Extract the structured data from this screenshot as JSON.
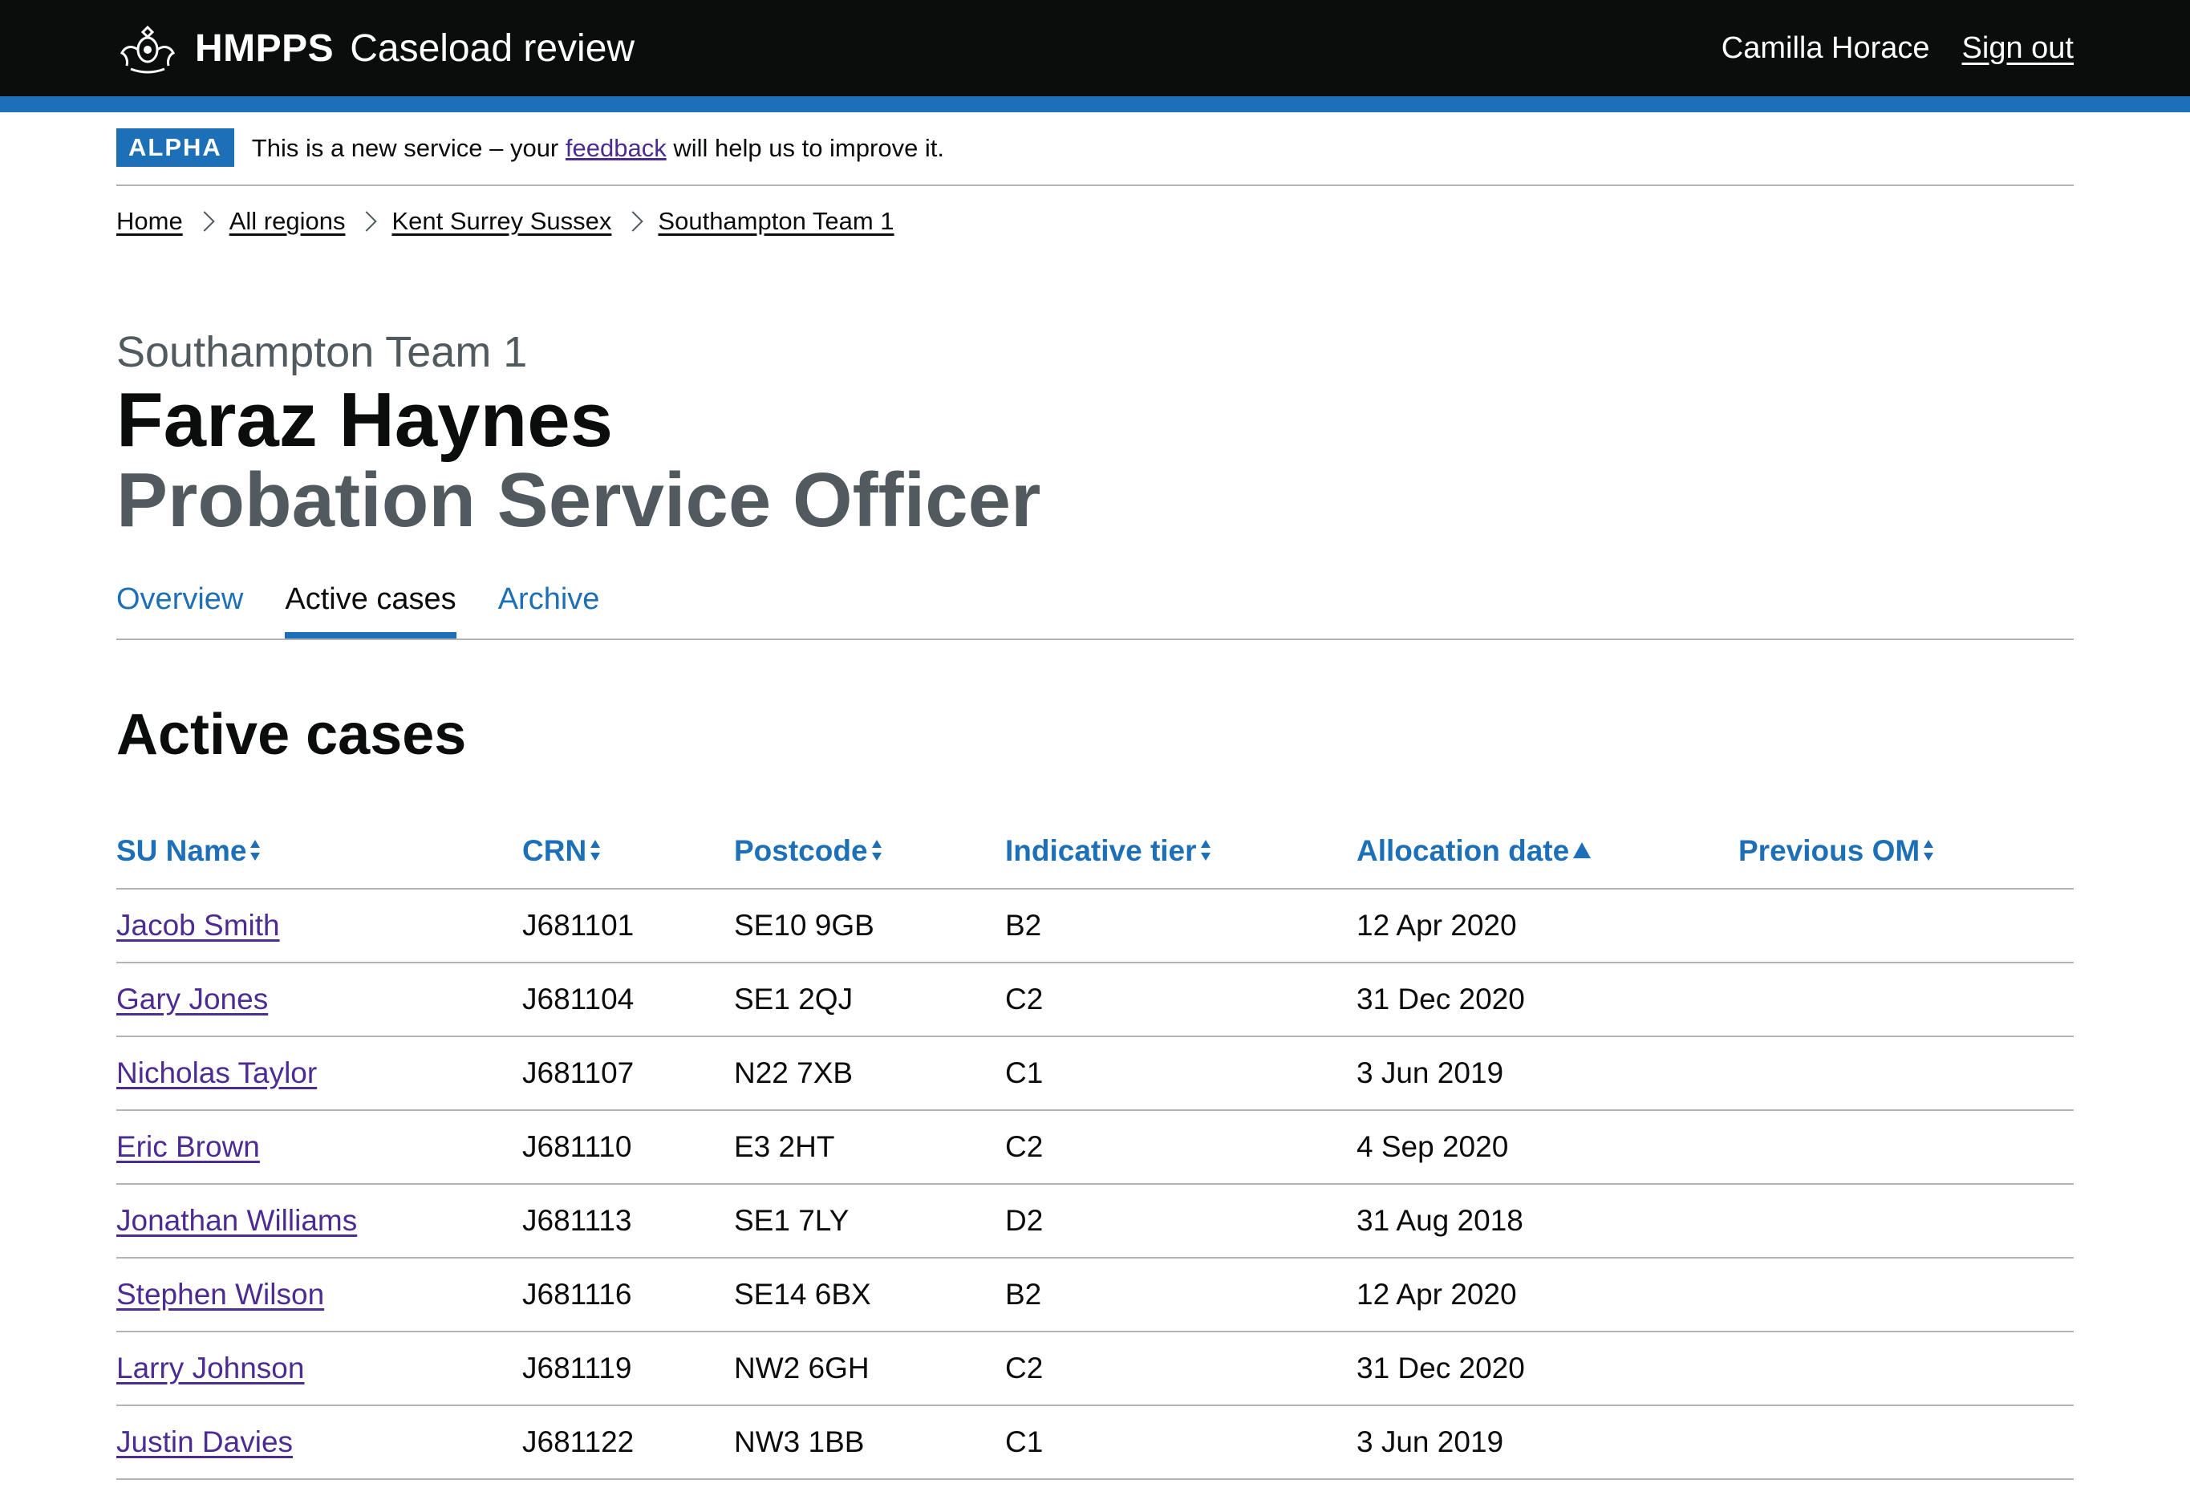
{
  "header": {
    "org": "HMPPS",
    "service": "Caseload review",
    "user_name": "Camilla Horace",
    "sign_out": "Sign out"
  },
  "phase_banner": {
    "tag": "ALPHA",
    "text_before": "This is a new service – your",
    "link": "feedback",
    "text_after": "will help us to improve it."
  },
  "breadcrumbs": [
    "Home",
    "All regions",
    "Kent Surrey Sussex",
    "Southampton Team 1"
  ],
  "caption": "Southampton Team 1",
  "title": "Faraz Haynes",
  "subtitle": "Probation Service Officer",
  "tabs": [
    {
      "label": "Overview",
      "active": false
    },
    {
      "label": "Active cases",
      "active": true
    },
    {
      "label": "Archive",
      "active": false
    }
  ],
  "section_heading": "Active cases",
  "table": {
    "headers": [
      {
        "label": "SU Name",
        "sort": "both"
      },
      {
        "label": "CRN",
        "sort": "both"
      },
      {
        "label": "Postcode",
        "sort": "both"
      },
      {
        "label": "Indicative tier",
        "sort": "both"
      },
      {
        "label": "Allocation date",
        "sort": "ascending"
      },
      {
        "label": "Previous OM",
        "sort": "both"
      }
    ],
    "rows": [
      [
        "Jacob Smith",
        "J681101",
        "SE10 9GB",
        "B2",
        "12 Apr 2020",
        ""
      ],
      [
        "Gary Jones",
        "J681104",
        "SE1 2QJ",
        "C2",
        "31 Dec 2020",
        ""
      ],
      [
        "Nicholas Taylor",
        "J681107",
        "N22 7XB",
        "C1",
        "3 Jun 2019",
        ""
      ],
      [
        "Eric Brown",
        "J681110",
        "E3 2HT",
        "C2",
        "4 Sep 2020",
        ""
      ],
      [
        "Jonathan Williams",
        "J681113",
        "SE1 7LY",
        "D2",
        "31 Aug 2018",
        ""
      ],
      [
        "Stephen Wilson",
        "J681116",
        "SE14 6BX",
        "B2",
        "12 Apr 2020",
        ""
      ],
      [
        "Larry Johnson",
        "J681119",
        "NW2 6GH",
        "C2",
        "31 Dec 2020",
        ""
      ],
      [
        "Justin Davies",
        "J681122",
        "NW3 1BB",
        "C1",
        "3 Jun 2019",
        ""
      ]
    ]
  },
  "colors": {
    "header_bg": "#0b0c0c",
    "accent": "#1d70b8",
    "visited_link": "#4c2c92",
    "secondary_text": "#505a5f",
    "border": "#b1b4b6"
  },
  "icons": {
    "crest": "royal-crest-icon",
    "breadcrumb_separator": "chevron-right-icon",
    "sort_both": "sort-arrows-icon",
    "sort_ascending": "sort-ascending-icon"
  }
}
